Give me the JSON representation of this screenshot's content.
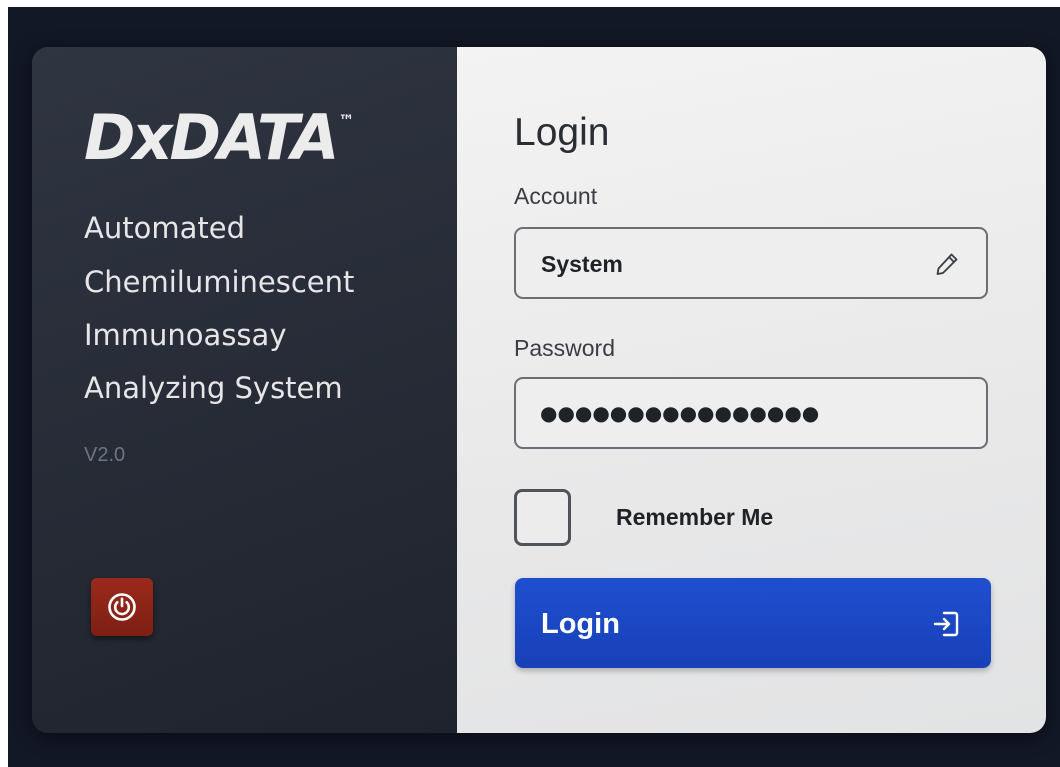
{
  "brand": {
    "logo_text": "DxDATA",
    "trademark": "™",
    "subtitle_lines": [
      "Automated",
      "Chemiluminescent",
      "Immunoassay",
      "Analyzing System"
    ],
    "version": "V2.0"
  },
  "power_button": {
    "icon": "power-icon",
    "color": "#8b2418"
  },
  "login_form": {
    "title": "Login",
    "account": {
      "label": "Account",
      "value": "System",
      "icon": "pencil-icon"
    },
    "password": {
      "label": "Password",
      "masked_value": "●●●●●●●●●●●●●●●●"
    },
    "remember_me": {
      "label": "Remember Me",
      "checked": false
    },
    "submit": {
      "label": "Login",
      "icon": "login-arrow-icon",
      "color": "#1d4acb"
    }
  }
}
